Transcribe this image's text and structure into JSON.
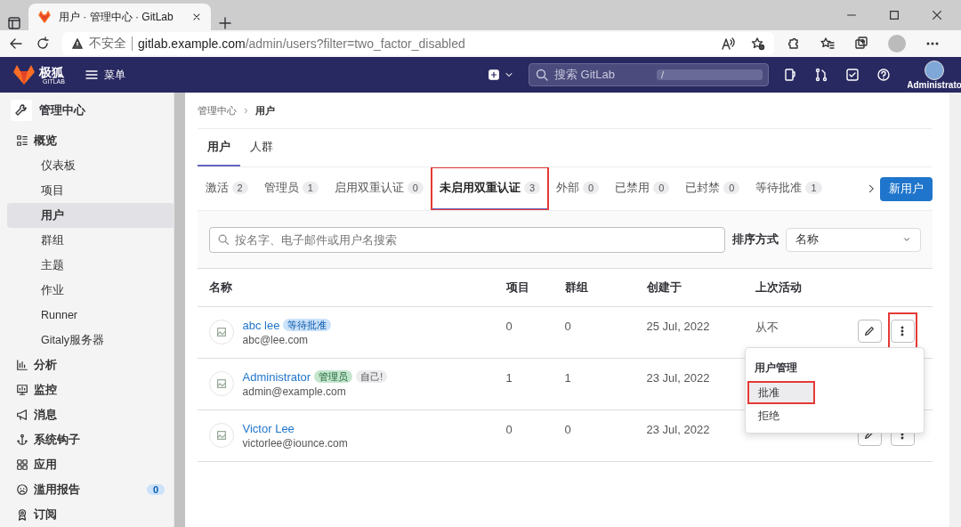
{
  "browser": {
    "tab_title": "用户 · 管理中心 · GitLab",
    "security": "不安全",
    "host": "gitlab.example.com",
    "path": "/admin/users?filter=two_factor_disabled"
  },
  "header": {
    "logo": "极狐",
    "logo_sub": "GITLAB",
    "menu": "菜单",
    "search_placeholder": "搜索 GitLab",
    "search_key": "/",
    "user": "Administrato"
  },
  "sidebar": {
    "title": "管理中心",
    "sections": [
      {
        "label": "概览",
        "children": [
          {
            "label": "仪表板",
            "selected": false
          },
          {
            "label": "项目",
            "selected": false
          },
          {
            "label": "用户",
            "selected": true
          },
          {
            "label": "群组",
            "selected": false
          },
          {
            "label": "主题",
            "selected": false
          },
          {
            "label": "作业",
            "selected": false
          },
          {
            "label": "Runner",
            "selected": false
          },
          {
            "label": "Gitaly服务器",
            "selected": false
          }
        ]
      },
      {
        "label": "分析"
      },
      {
        "label": "监控"
      },
      {
        "label": "消息"
      },
      {
        "label": "系统钩子"
      },
      {
        "label": "应用"
      },
      {
        "label": "滥用报告",
        "badge": "0"
      },
      {
        "label": "订阅"
      }
    ]
  },
  "breadcrumb": [
    "管理中心",
    "用户"
  ],
  "top_tabs": [
    {
      "label": "用户",
      "selected": true
    },
    {
      "label": "人群",
      "selected": false
    }
  ],
  "filter_tabs": [
    {
      "label": "激活",
      "count": "2",
      "selected": false,
      "annotated": false
    },
    {
      "label": "管理员",
      "count": "1",
      "selected": false,
      "annotated": false
    },
    {
      "label": "启用双重认证",
      "count": "0",
      "selected": false,
      "annotated": false
    },
    {
      "label": "未启用双重认证",
      "count": "3",
      "selected": true,
      "annotated": true
    },
    {
      "label": "外部",
      "count": "0",
      "selected": false,
      "annotated": false
    },
    {
      "label": "已禁用",
      "count": "0",
      "selected": false,
      "annotated": false
    },
    {
      "label": "已封禁",
      "count": "0",
      "selected": false,
      "annotated": false
    },
    {
      "label": "等待批准",
      "count": "1",
      "selected": false,
      "annotated": false
    }
  ],
  "new_user_button": "新用户",
  "search": {
    "placeholder": "按名字、电子邮件或用户名搜索"
  },
  "sort": {
    "label": "排序方式",
    "value": "名称"
  },
  "table": {
    "columns": [
      "名称",
      "项目",
      "群组",
      "创建于",
      "上次活动"
    ],
    "rows": [
      {
        "name": "abc lee",
        "email": "abc@lee.com",
        "badges": [
          {
            "text": "等待批准",
            "kind": "pending"
          }
        ],
        "projects": "0",
        "groups": "0",
        "created": "25 Jul, 2022",
        "last_activity": "从不",
        "actions": true,
        "more_annotated": true
      },
      {
        "name": "Administrator",
        "email": "admin@example.com",
        "badges": [
          {
            "text": "管理员",
            "kind": "admin"
          },
          {
            "text": "自己!",
            "kind": "self"
          }
        ],
        "projects": "1",
        "groups": "1",
        "created": "23 Jul, 2022"
      },
      {
        "name": "Victor Lee",
        "email": "victorlee@iounce.com",
        "badges": [],
        "projects": "0",
        "groups": "0",
        "created": "23 Jul, 2022",
        "actions": true
      }
    ]
  },
  "dropdown": {
    "heading": "用户管理",
    "items": [
      {
        "label": "批准",
        "selected": true,
        "annotated": true
      },
      {
        "label": "拒绝",
        "selected": false,
        "annotated": false
      }
    ]
  }
}
